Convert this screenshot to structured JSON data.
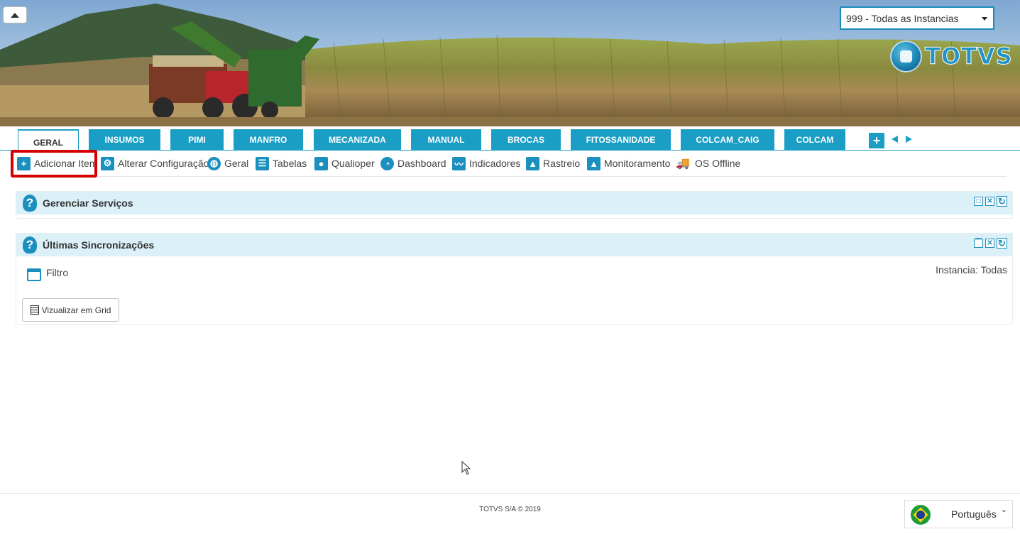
{
  "header": {
    "instance_select": "999 - Todas as Instancias",
    "logo_text": "TOTVS"
  },
  "tabs": [
    {
      "label": "GERAL",
      "active": true
    },
    {
      "label": "INSUMOS"
    },
    {
      "label": "PIMI"
    },
    {
      "label": "MANFRO"
    },
    {
      "label": "MECANIZADA"
    },
    {
      "label": "MANUAL"
    },
    {
      "label": "BROCAS"
    },
    {
      "label": "FITOSSANIDADE"
    },
    {
      "label": "COLCAM_CAIG"
    },
    {
      "label": "COLCAM"
    }
  ],
  "tab_controls": {
    "add": "+"
  },
  "toolbar": {
    "items": [
      {
        "label": "Adicionar Item",
        "icon": "plus-icon"
      },
      {
        "label": "Alterar Configuração",
        "icon": "gear-icon"
      },
      {
        "label": "Geral",
        "icon": "globe-icon"
      },
      {
        "label": "Tabelas",
        "icon": "table-icon"
      },
      {
        "label": "Qualioper",
        "icon": "user-icon"
      },
      {
        "label": "Dashboard",
        "icon": "gauge-icon"
      },
      {
        "label": "Indicadores",
        "icon": "chart-line-icon"
      },
      {
        "label": "Rastreio",
        "icon": "map-icon"
      },
      {
        "label": "Monitoramento",
        "icon": "map-pin-icon"
      },
      {
        "label": "OS Offline",
        "icon": "truck-icon"
      }
    ]
  },
  "panels": {
    "services": {
      "title": "Gerenciar Serviços"
    },
    "sync": {
      "title": "Últimas Sincronizações",
      "filter_label": "Filtro",
      "instance_text": "Instancia: Todas",
      "grid_button": "Vizualizar em Grid"
    }
  },
  "footer": {
    "copyright": "TOTVS S/A © 2019",
    "language": "Português"
  },
  "colors": {
    "accent": "#1b9ec5",
    "panel_header": "#dcf0f8",
    "highlight": "#d40000"
  }
}
